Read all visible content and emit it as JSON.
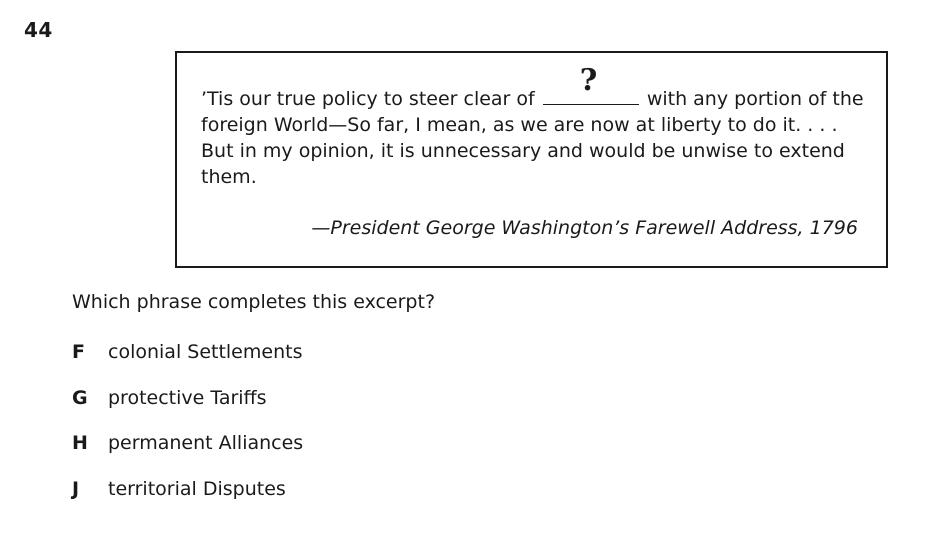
{
  "question_number": "44",
  "excerpt": {
    "text_before_blank": "’Tis our true policy to steer clear of",
    "blank_mark": "?",
    "text_after_blank": "with any portion of the foreign World—So far, I mean, as we are now at liberty to do it. . . . But in my opinion, it is unnecessary and would be unwise to extend them.",
    "attribution": "—President George Washington’s Farewell Address, 1796"
  },
  "prompt": "Which phrase completes this excerpt?",
  "choices": [
    {
      "letter": "F",
      "text": "colonial Settlements"
    },
    {
      "letter": "G",
      "text": "protective Tariffs"
    },
    {
      "letter": "H",
      "text": "permanent Alliances"
    },
    {
      "letter": "J",
      "text": "territorial Disputes"
    }
  ]
}
